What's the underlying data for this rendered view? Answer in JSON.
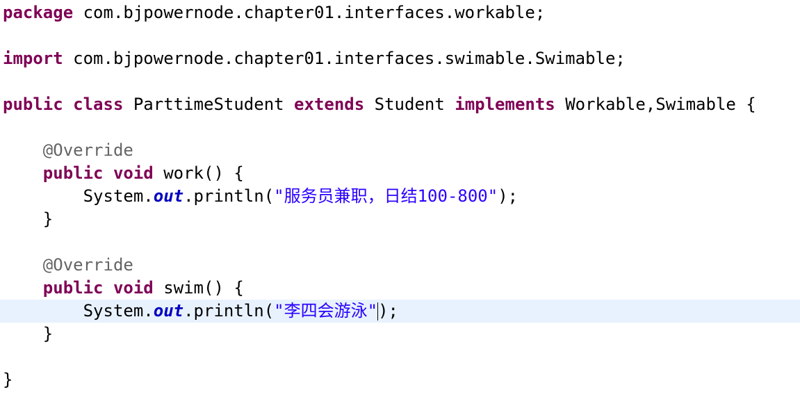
{
  "code_lines": [
    [
      {
        "type": "keyword",
        "text": "package"
      },
      {
        "type": "plain",
        "text": " com.bjpowernode.chapter01.interfaces.workable;"
      }
    ],
    [],
    [
      {
        "type": "keyword",
        "text": "import"
      },
      {
        "type": "plain",
        "text": " com.bjpowernode.chapter01.interfaces.swimable.Swimable;"
      }
    ],
    [],
    [
      {
        "type": "keyword",
        "text": "public"
      },
      {
        "type": "plain",
        "text": " "
      },
      {
        "type": "keyword",
        "text": "class"
      },
      {
        "type": "plain",
        "text": " ParttimeStudent "
      },
      {
        "type": "keyword",
        "text": "extends"
      },
      {
        "type": "plain",
        "text": " Student "
      },
      {
        "type": "keyword",
        "text": "implements"
      },
      {
        "type": "plain",
        "text": " Workable,Swimable {"
      }
    ],
    [],
    [
      {
        "type": "plain",
        "text": "    "
      },
      {
        "type": "annotation",
        "text": "@Override"
      }
    ],
    [
      {
        "type": "plain",
        "text": "    "
      },
      {
        "type": "keyword",
        "text": "public"
      },
      {
        "type": "plain",
        "text": " "
      },
      {
        "type": "keyword",
        "text": "void"
      },
      {
        "type": "plain",
        "text": " work() {"
      }
    ],
    [
      {
        "type": "plain",
        "text": "        System."
      },
      {
        "type": "field",
        "text": "out"
      },
      {
        "type": "plain",
        "text": ".println("
      },
      {
        "type": "string",
        "text": "\"服务员兼职，日结100-800\""
      },
      {
        "type": "plain",
        "text": ");"
      }
    ],
    [
      {
        "type": "plain",
        "text": "    }"
      }
    ],
    [],
    [
      {
        "type": "plain",
        "text": "    "
      },
      {
        "type": "annotation",
        "text": "@Override"
      }
    ],
    [
      {
        "type": "plain",
        "text": "    "
      },
      {
        "type": "keyword",
        "text": "public"
      },
      {
        "type": "plain",
        "text": " "
      },
      {
        "type": "keyword",
        "text": "void"
      },
      {
        "type": "plain",
        "text": " swim() {"
      }
    ],
    [
      {
        "type": "plain",
        "text": "        System."
      },
      {
        "type": "field",
        "text": "out"
      },
      {
        "type": "plain",
        "text": ".println("
      },
      {
        "type": "string",
        "text": "\"李四会游泳\""
      },
      {
        "type": "caret",
        "text": ""
      },
      {
        "type": "plain",
        "text": ");"
      }
    ],
    [
      {
        "type": "plain",
        "text": "    }"
      }
    ],
    [],
    [
      {
        "type": "plain",
        "text": "}"
      }
    ]
  ],
  "current_line_index": 13,
  "colors": {
    "keyword": "#7f0055",
    "annotation": "#646464",
    "string": "#2a00ff",
    "field": "#0000c0",
    "current_line_highlight": "#e8f2fe"
  }
}
